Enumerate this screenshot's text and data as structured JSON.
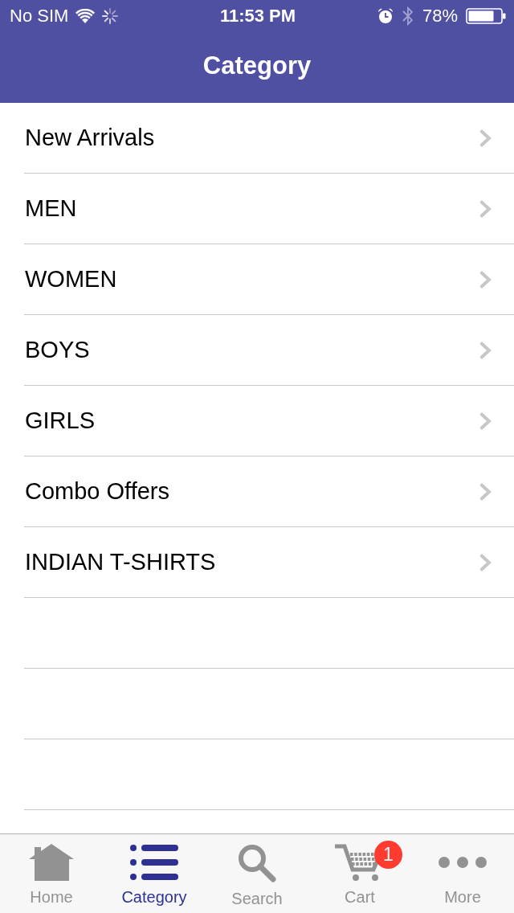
{
  "status_bar": {
    "carrier": "No SIM",
    "time": "11:53 PM",
    "battery": "78%"
  },
  "nav_bar": {
    "title": "Category"
  },
  "categories": [
    {
      "label": "New Arrivals"
    },
    {
      "label": "MEN"
    },
    {
      "label": "WOMEN"
    },
    {
      "label": "BOYS"
    },
    {
      "label": "GIRLS"
    },
    {
      "label": "Combo Offers"
    },
    {
      "label": "INDIAN T-SHIRTS"
    }
  ],
  "tab_bar": [
    {
      "kind": "home",
      "label": "Home",
      "selected": false
    },
    {
      "kind": "list",
      "label": "Category",
      "selected": true
    },
    {
      "kind": "search",
      "label": "Search",
      "selected": false
    },
    {
      "kind": "cart",
      "label": "Cart",
      "selected": false,
      "badge": "1"
    },
    {
      "kind": "more",
      "label": "More",
      "selected": false
    }
  ]
}
